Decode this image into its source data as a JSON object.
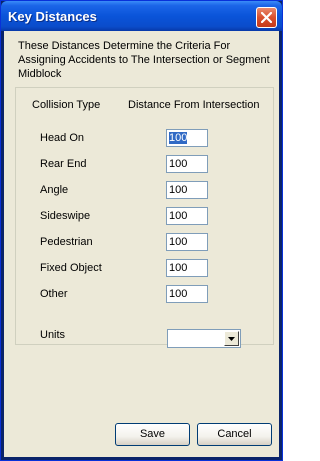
{
  "window": {
    "title": "Key Distances"
  },
  "description": "These Distances Determine the Criteria For Assigning Accidents to The Intersection or Segment Midblock",
  "table": {
    "col_type": "Collision Type",
    "col_distance": "Distance From Intersection",
    "rows": [
      {
        "label": "Head On",
        "value": "100"
      },
      {
        "label": "Rear End",
        "value": "100"
      },
      {
        "label": "Angle",
        "value": "100"
      },
      {
        "label": "Sideswipe",
        "value": "100"
      },
      {
        "label": "Pedestrian",
        "value": "100"
      },
      {
        "label": "Fixed Object",
        "value": "100"
      },
      {
        "label": "Other",
        "value": "100"
      }
    ]
  },
  "units": {
    "label": "Units",
    "value": ""
  },
  "buttons": {
    "save": "Save",
    "cancel": "Cancel"
  },
  "icons": {
    "close": "close-icon",
    "dropdown": "chevron-down-icon"
  },
  "colors": {
    "titlebar": "#0A54D9",
    "dialog_bg": "#ECE9D8",
    "selection": "#316AC5",
    "close": "#D9502E"
  }
}
